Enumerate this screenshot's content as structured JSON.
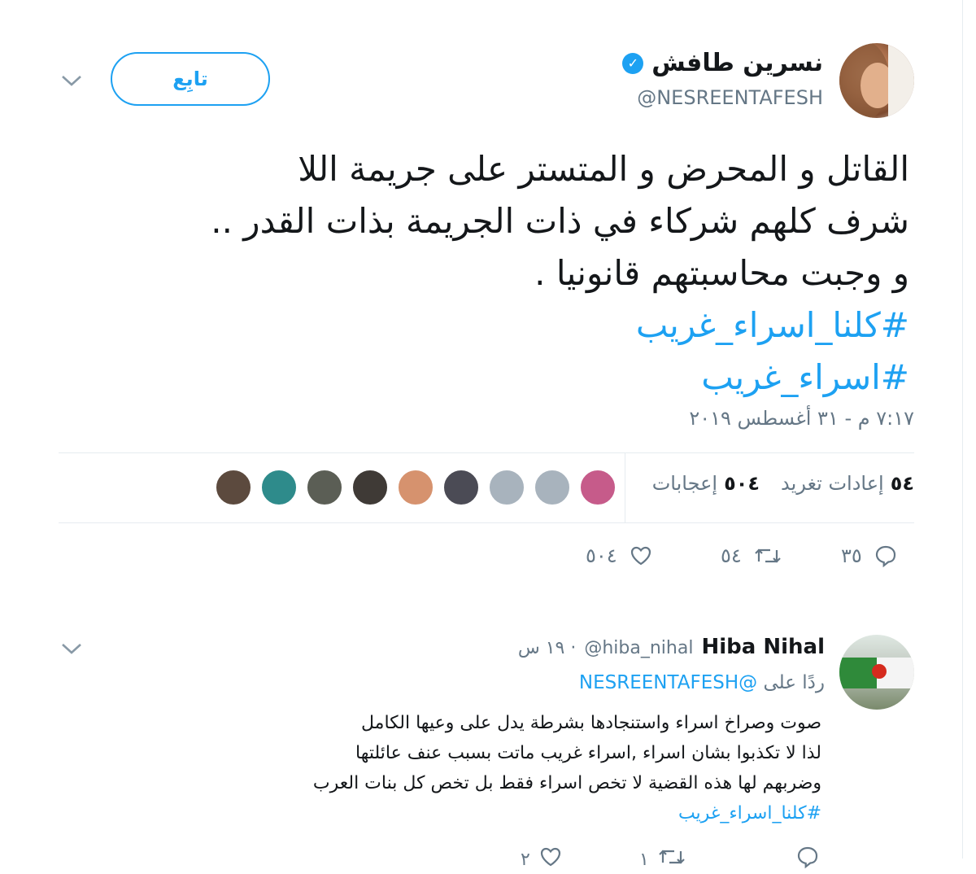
{
  "tweet": {
    "display_name": "نسرين طافش",
    "handle": "@NESREENTAFESH",
    "follow_label": "تابِع",
    "lines": [
      "القاتل و المحرض و المتستر على جريمة اللا",
      "شرف كلهم شركاء في ذات الجريمة بذات القدر ..",
      "و وجبت محاسبتهم قانونيا ."
    ],
    "hashtags": [
      "#كلنا_اسراء_غريب",
      "#اسراء_غريب"
    ],
    "timestamp": "٧:١٧ م - ٣١ أغسطس ٢٠١٩",
    "retweets_count": "٥٤",
    "retweets_label": "إعادات تغريد",
    "likes_count": "٥٠٤",
    "likes_label": "إعجابات",
    "actions": {
      "replies": "٣٥",
      "retweets": "٥٤",
      "likes": "٥٠٤"
    },
    "likers": [
      "#c65b8a",
      "#a8b3bd",
      "#a8b3bd",
      "#4b4b55",
      "#d6926e",
      "#3f3a36",
      "#5b5e55",
      "#2e8b8b",
      "#5c4a3e"
    ]
  },
  "reply": {
    "name": "Hiba Nihal",
    "handle": "@hiba_nihal",
    "time": "١٩ س",
    "reply_to_label": "ردًا على",
    "reply_to_handle": "@NESREENTAFESH",
    "lines": [
      "صوت وصراخ اسراء واستنجادها بشرطة يدل على وعيها الكامل",
      "لذا لا تكذبوا بشان اسراء ,اسراء غريب ماتت بسبب عنف عائلتها",
      "وضربهم لها هذه القضية لا تخص اسراء فقط بل تخص كل بنات العرب"
    ],
    "hashtag": "#كلنا_اسراء_غريب",
    "actions": {
      "replies": "",
      "retweets": "١",
      "likes": "٢"
    }
  },
  "colors": {
    "accent": "#1da1f2",
    "muted": "#657786",
    "text": "#14171a",
    "divider": "#e6ecf0"
  },
  "icons": [
    "verified-badge-icon",
    "chevron-down-icon",
    "reply-icon",
    "retweet-icon",
    "heart-icon"
  ]
}
